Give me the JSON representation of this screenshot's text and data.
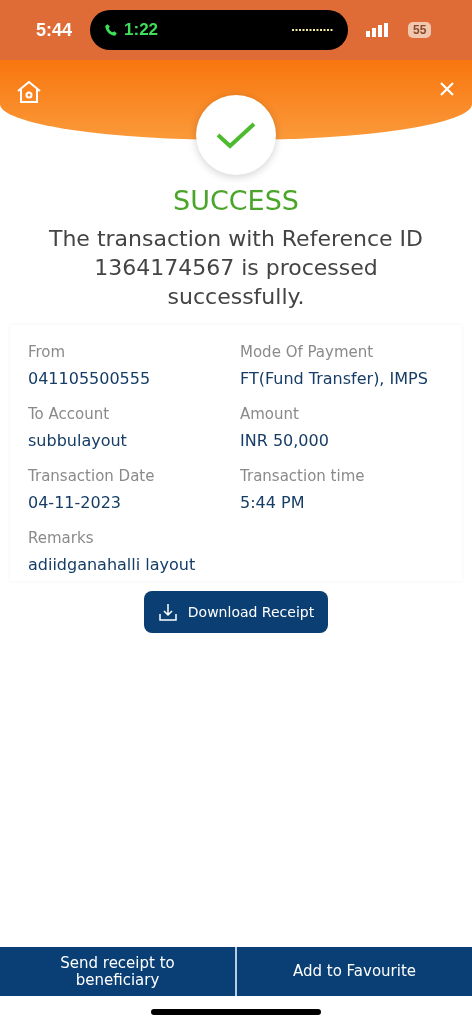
{
  "status_bar": {
    "time": "5:44",
    "call_time": "1:22",
    "battery": "55"
  },
  "result": {
    "title": "SUCCESS",
    "message": "The transaction with Reference ID 1364174567 is processed successfully."
  },
  "details": [
    {
      "label": "From",
      "value": "041105500555"
    },
    {
      "label": "Mode Of Payment",
      "value": "FT(Fund Transfer), IMPS"
    },
    {
      "label": "To Account",
      "value": "subbulayout"
    },
    {
      "label": "Amount",
      "value": "INR 50,000"
    },
    {
      "label": "Transaction Date",
      "value": "04-11-2023"
    },
    {
      "label": "Transaction time",
      "value": "5:44 PM"
    },
    {
      "label": "Remarks",
      "value": "adiidganahalli layout"
    }
  ],
  "download_button": "Download Receipt",
  "bottom_actions": [
    "Send receipt to beneficiary",
    "Add to Favourite"
  ]
}
